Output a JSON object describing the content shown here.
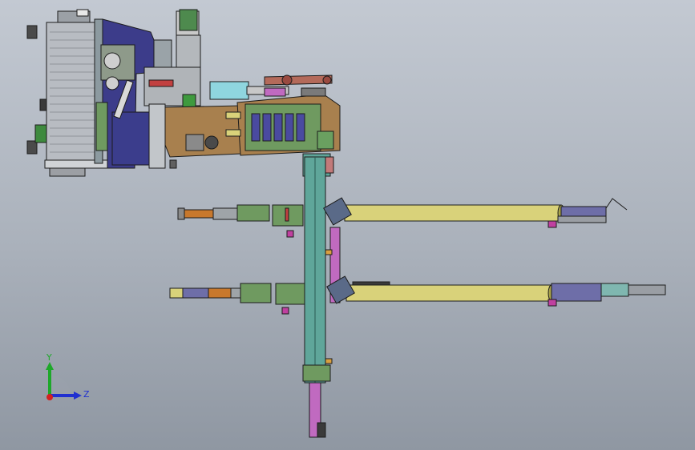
{
  "viewport": {
    "background_top": "#c3c9d2",
    "background_bottom": "#8f97a2"
  },
  "colors": {
    "housing_silver": "#b8bcc2",
    "motor_navy": "#3c3c8a",
    "body_bronze": "#a8804e",
    "panel_green": "#6f9a60",
    "column_teal": "#5fa69a",
    "arm_yellow": "#d9d27a",
    "rod_magenta": "#c06ac0",
    "tip_orange": "#c8782c",
    "cylinder_cyan": "#8fd6df",
    "slate_blue": "#6e6ea8",
    "edge": "#1c1c1c"
  },
  "triad": {
    "y_label": "Y",
    "z_label": "Z",
    "y_color": "#1ea82a",
    "z_color": "#2030d0",
    "origin_color": "#d42020"
  }
}
